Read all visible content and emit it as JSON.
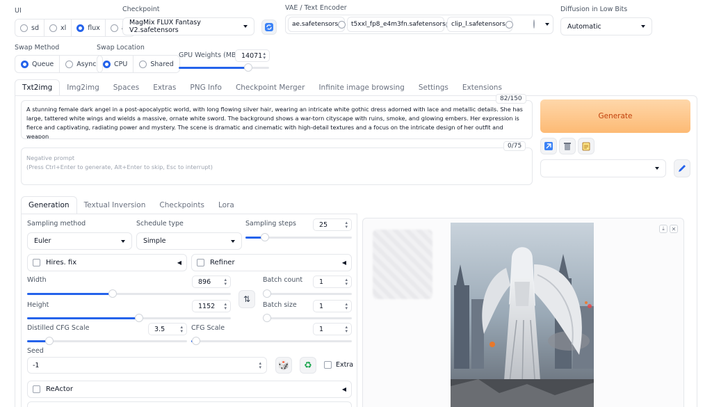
{
  "top": {
    "ui_label": "UI",
    "ui_options": [
      "sd",
      "xl",
      "flux",
      "all"
    ],
    "checkpoint_label": "Checkpoint",
    "checkpoint_value": "MagMix FLUX Fantasy V2.safetensors",
    "vae_label": "VAE / Text Encoder",
    "vae_items": [
      "ae.safetensors",
      "t5xxl_fp8_e4m3fn.safetensors",
      "clip_l.safetensors"
    ],
    "lowbits_label": "Diffusion in Low Bits",
    "lowbits_value": "Automatic",
    "swap_method_label": "Swap Method",
    "swap_method_options": [
      "Queue",
      "Async"
    ],
    "swap_location_label": "Swap Location",
    "swap_location_options": [
      "CPU",
      "Shared"
    ],
    "gpu_weights_label": "GPU Weights (MB)",
    "gpu_weights_value": "14071",
    "gpu_weights_fraction": 0.77
  },
  "tabs": [
    "Txt2img",
    "Img2img",
    "Spaces",
    "Extras",
    "PNG Info",
    "Checkpoint Merger",
    "Infinite image browsing",
    "Settings",
    "Extensions"
  ],
  "prompt": {
    "text": "A stunning female dark angel in a post-apocalyptic world, with long flowing silver hair, wearing an intricate white gothic dress adorned with lace and metallic details. She has large, tattered white wings and wields a massive, ornate white sword. The background shows a war-torn cityscape with ruins, smoke, and glowing embers. Her expression is fierce and captivating, radiating power and mystery. The scene is dramatic and cinematic with high-detail textures and a focus on the intricate design of her outfit and weapon",
    "counter": "82/150",
    "neg_placeholder_1": "Negative prompt",
    "neg_placeholder_2": "(Press Ctrl+Enter to generate, Alt+Enter to skip, Esc to interrupt)",
    "neg_counter": "0/75"
  },
  "generate_label": "Generate",
  "subtabs": [
    "Generation",
    "Textual Inversion",
    "Checkpoints",
    "Lora"
  ],
  "gen": {
    "sampling_method_label": "Sampling method",
    "sampling_method_value": "Euler",
    "schedule_type_label": "Schedule type",
    "schedule_type_value": "Simple",
    "sampling_steps_label": "Sampling steps",
    "sampling_steps_value": "25",
    "sampling_steps_fraction": 0.18,
    "hires_label": "Hires. fix",
    "refiner_label": "Refiner",
    "width_label": "Width",
    "width_value": "896",
    "width_fraction": 0.42,
    "height_label": "Height",
    "height_value": "1152",
    "height_fraction": 0.55,
    "batch_count_label": "Batch count",
    "batch_count_value": "1",
    "batch_size_label": "Batch size",
    "batch_size_value": "1",
    "dcfg_label": "Distilled CFG Scale",
    "dcfg_value": "3.5",
    "dcfg_fraction": 0.14,
    "cfg_label": "CFG Scale",
    "cfg_value": "1",
    "cfg_fraction": 0.03,
    "seed_label": "Seed",
    "seed_value": "-1",
    "extra_label": "Extra",
    "reactor_label": "ReActor"
  },
  "colors": {
    "accent": "#2563eb",
    "generate_bg": "#fdba74",
    "generate_text": "#c2410c"
  }
}
